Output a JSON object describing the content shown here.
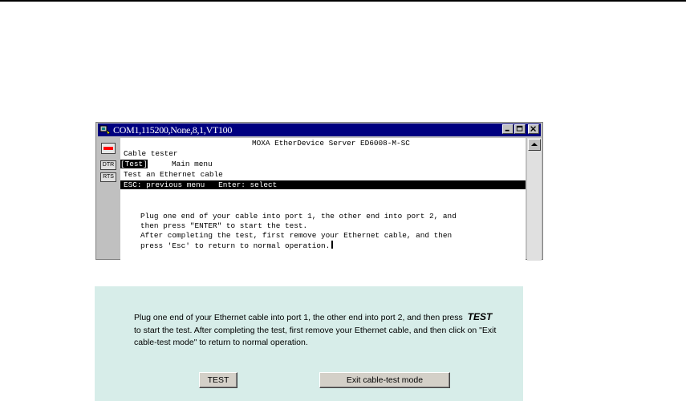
{
  "terminal": {
    "title": "COM1,115200,None,8,1,VT100",
    "leds": [
      "DTR",
      "RTS"
    ],
    "screen": {
      "header": "MOXA EtherDevice Server ED6008-M-SC",
      "subtitle": "Cable tester",
      "menu_selected": "[Test]",
      "menu_main": "Main menu",
      "menu_desc": "Test an Ethernet cable",
      "status_bar": "ESC: previous menu   Enter: select",
      "msg1": "Plug one end of your cable into port 1, the other end into port 2, and",
      "msg2": "then press \"ENTER\" to start the test.",
      "msg3": "After completing the test, first remove your Ethernet cable, and then",
      "msg4": "press 'Esc' to return to normal operation."
    }
  },
  "web": {
    "text_pre": "Plug one end of your Ethernet cable into port 1, the other end into port 2, and then press",
    "text_emph": "TEST",
    "text_post": "to start the test. After completing the test, first remove your Ethernet cable, and then click on \"Exit cable-test mode\" to return to normal operation.",
    "test_button": "TEST",
    "exit_button": "Exit cable-test mode"
  }
}
